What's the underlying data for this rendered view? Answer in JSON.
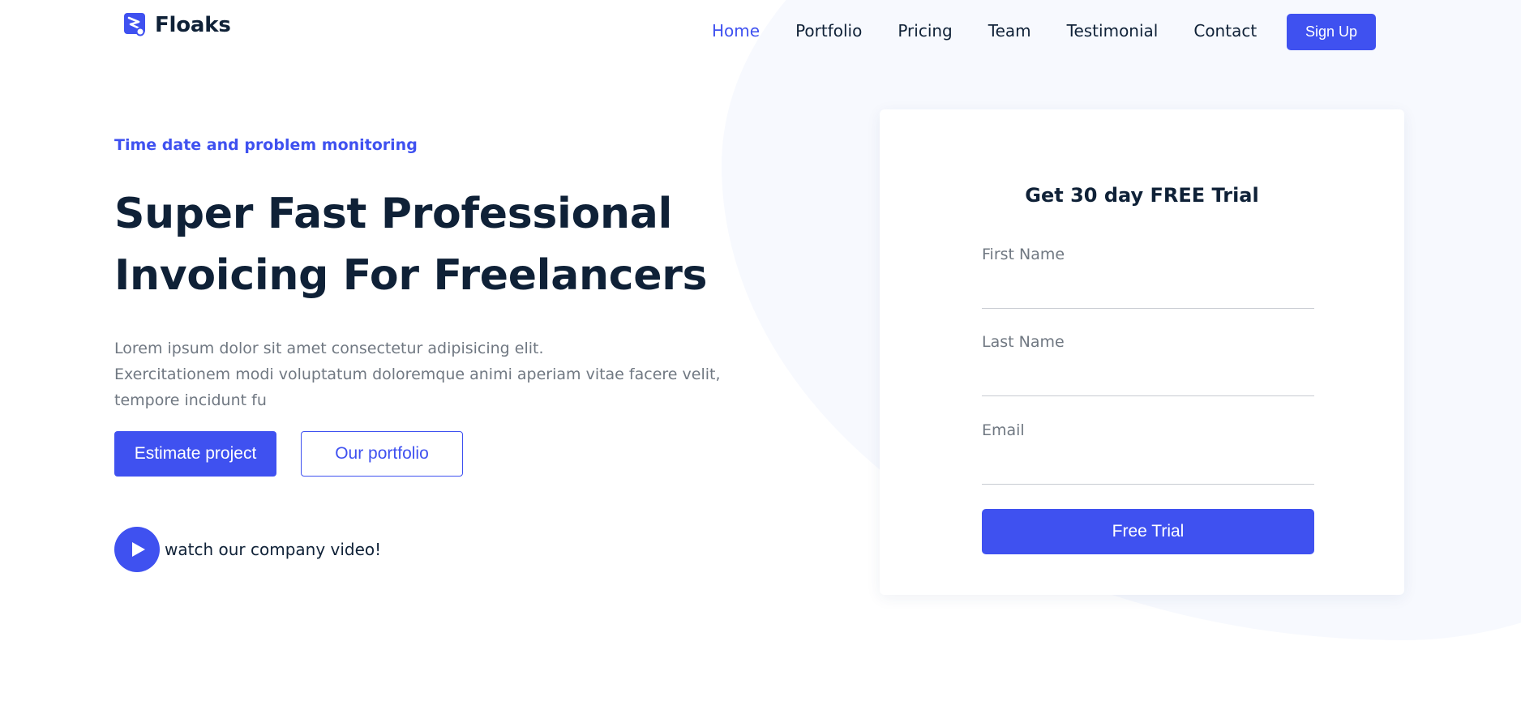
{
  "header": {
    "logo_text": "Floaks",
    "nav": [
      {
        "label": "Home",
        "active": true
      },
      {
        "label": "Portfolio"
      },
      {
        "label": "Pricing"
      },
      {
        "label": "Team"
      },
      {
        "label": "Testimonial"
      },
      {
        "label": "Contact"
      }
    ],
    "signup_label": "Sign Up"
  },
  "hero": {
    "eyebrow": "Time date and problem monitoring",
    "headline_line1": "Super Fast Professional",
    "headline_line2": "Invoicing For Freelancers",
    "desc_line1": "Lorem ipsum dolor sit amet consectetur adipisicing elit.",
    "desc_line2": "Exercitationem modi voluptatum doloremque animi aperiam vitae facere velit, tempore incidunt fu",
    "primary_button": "Estimate project",
    "secondary_button": "Our portfolio",
    "video_text": "watch our company video!"
  },
  "trial_form": {
    "title": "Get 30 day FREE Trial",
    "first_name_label": "First Name",
    "last_name_label": "Last Name",
    "email_label": "Email",
    "submit_label": "Free Trial"
  },
  "colors": {
    "accent": "#3f51f0",
    "heading": "#0f2137",
    "muted": "#707882",
    "background_blob": "#f7f9fe"
  },
  "icons": {
    "logo": "floaks-logo-icon",
    "video": "play-icon"
  }
}
